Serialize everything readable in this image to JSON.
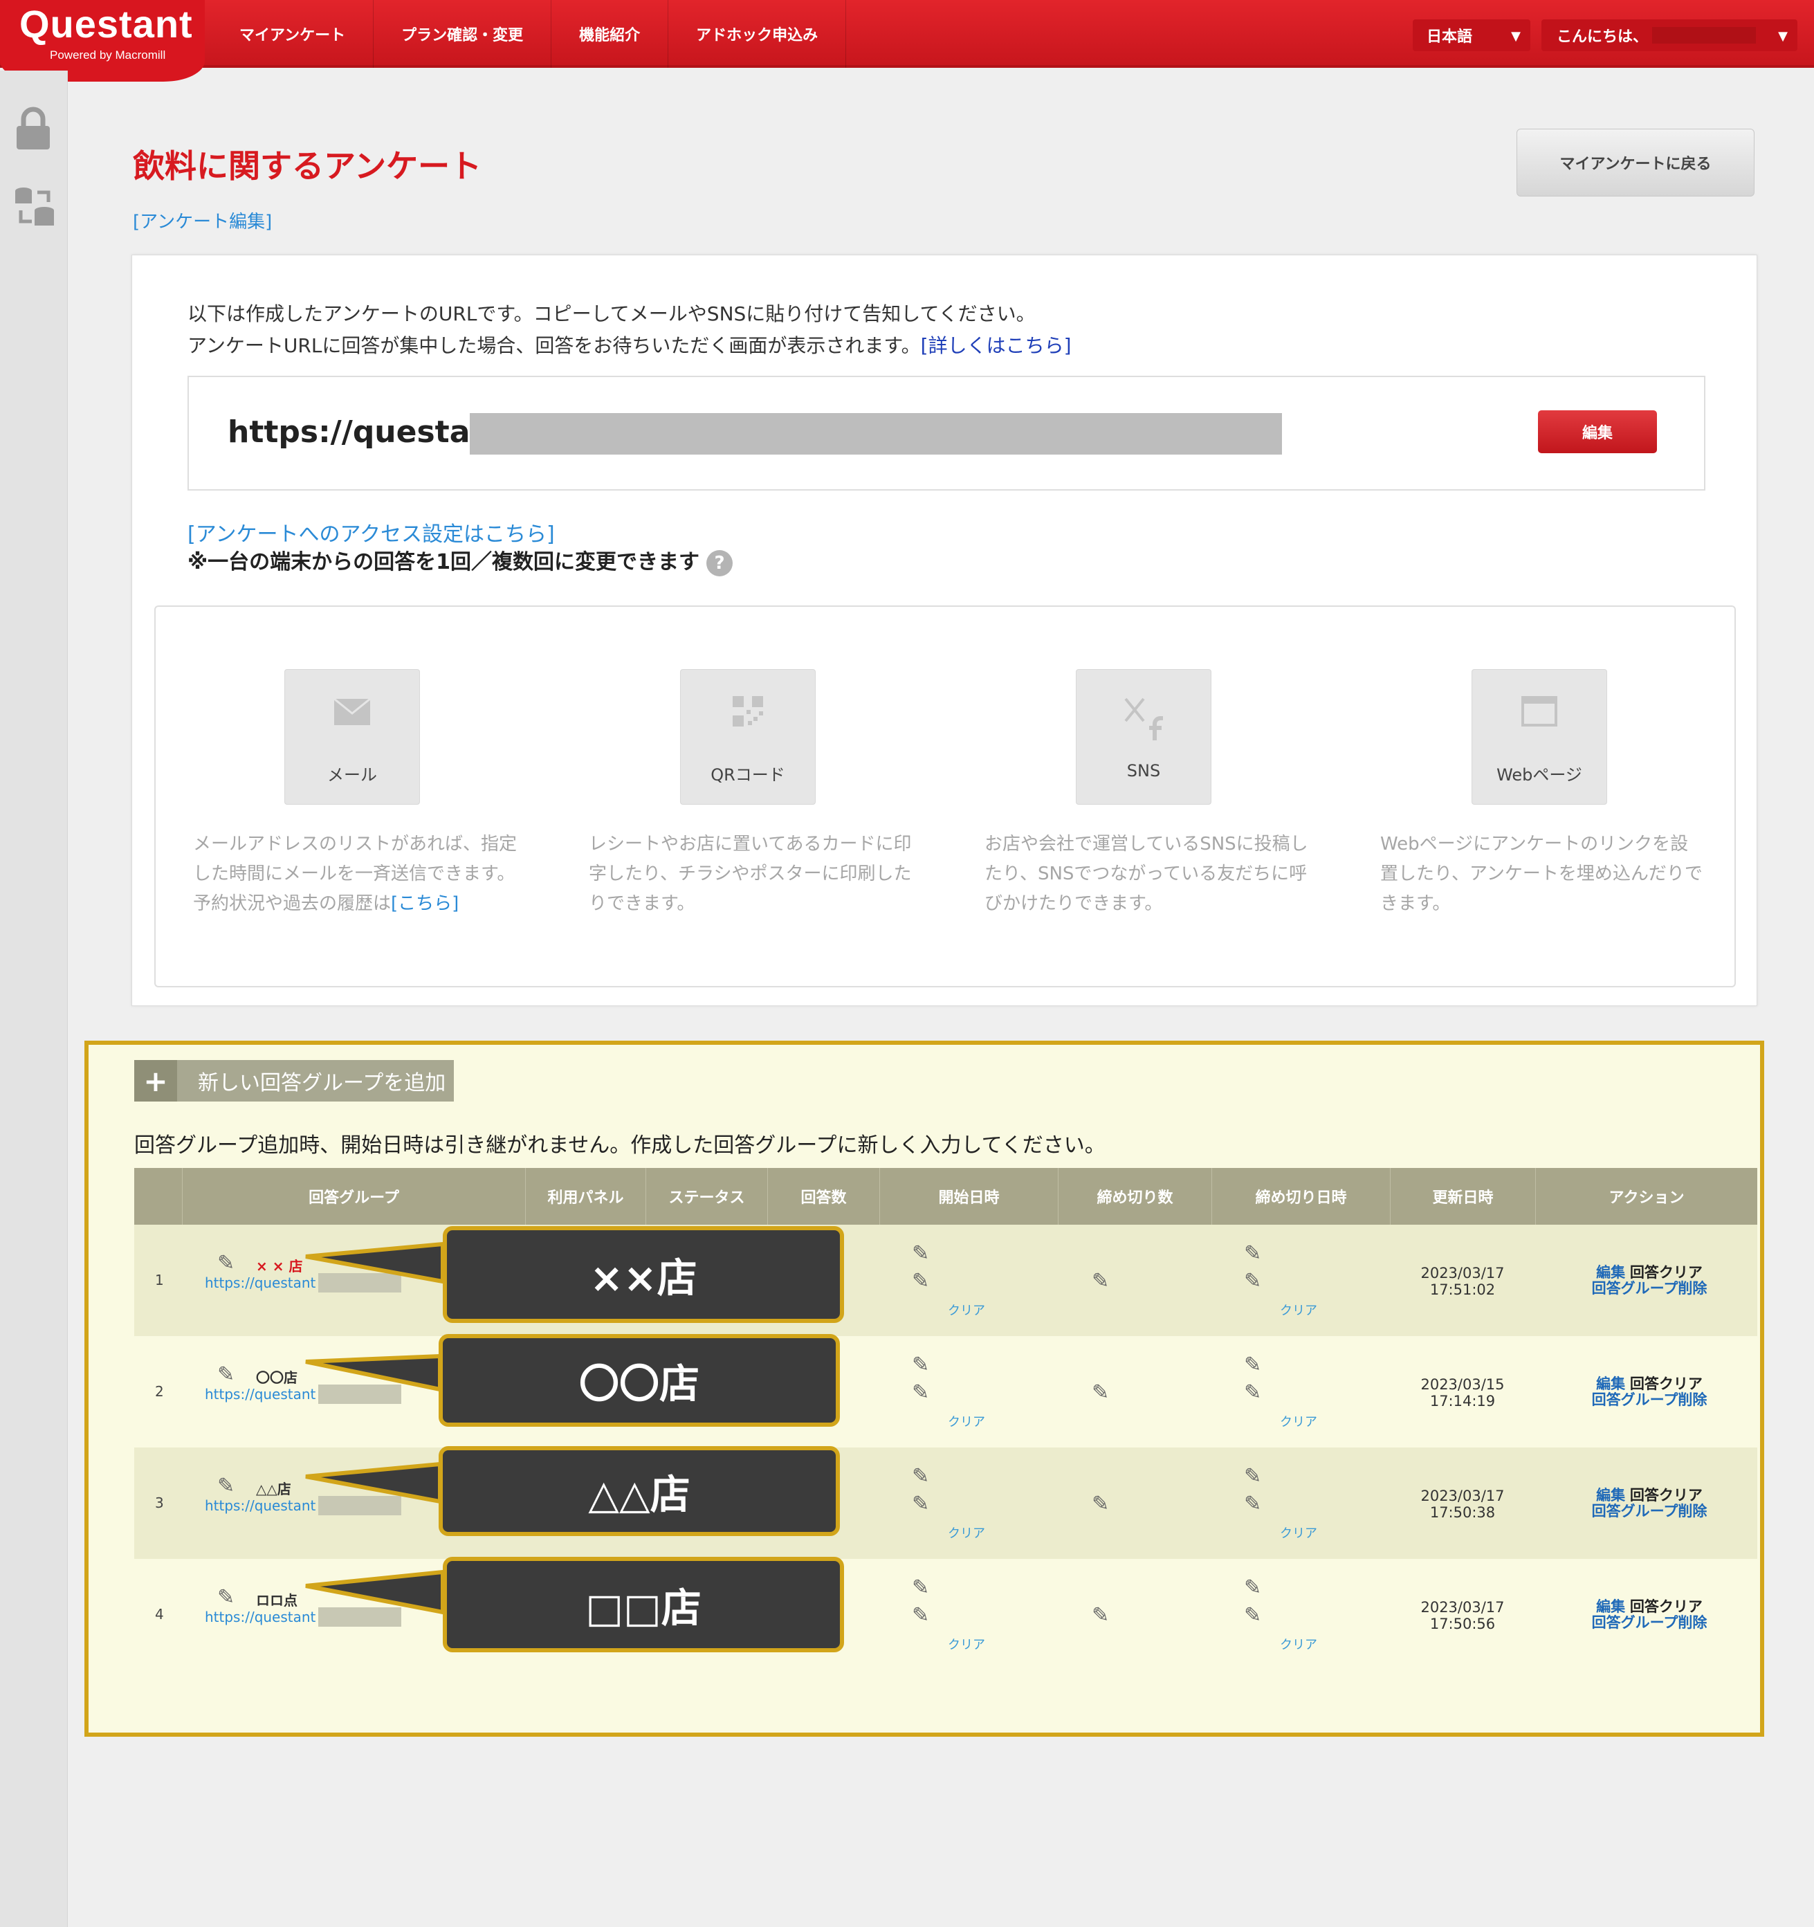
{
  "header": {
    "logo": "Questant",
    "logo_sub": "Powered by Macromill",
    "nav": [
      "マイアンケート",
      "プラン確認・変更",
      "機能紹介",
      "アドホック申込み"
    ],
    "language": "日本語",
    "greeting": "こんにちは、"
  },
  "sidebar": {
    "icons": [
      "lock-icon",
      "database-transfer-icon"
    ]
  },
  "page": {
    "title": "飲料に関するアンケート",
    "edit_link": "[アンケート編集]",
    "back_button": "マイアンケートに戻る"
  },
  "url_card": {
    "desc_line1": "以下は作成したアンケートのURLです。コピーしてメールやSNSに貼り付けて告知してください。",
    "desc_line2": "アンケートURLに回答が集中した場合、回答をお待ちいただく画面が表示されます。",
    "desc_link": "[詳しくはこちら]",
    "url": "https://questant",
    "edit_button": "編集",
    "access_link": "[アンケートへのアクセス設定はこちら]",
    "access_note": "※一台の端末からの回答を1回／複数回に変更できます",
    "help": "?"
  },
  "share": [
    {
      "label": "メール",
      "icon": "mail-icon",
      "desc": "メールアドレスのリストがあれば、指定した時間にメールを一斉送信できます。",
      "desc2": "予約状況や過去の履歴は",
      "link": "[こちら]"
    },
    {
      "label": "QRコード",
      "icon": "qr-code-icon",
      "desc": "レシートやお店に置いてあるカードに印字したり、チラシやポスターに印刷したりできます。",
      "desc2": "",
      "link": ""
    },
    {
      "label": "SNS",
      "icon": "x-facebook-icon",
      "desc": "お店や会社で運営しているSNSに投稿したり、SNSでつながっている友だちに呼びかけたりできます。",
      "desc2": "",
      "link": ""
    },
    {
      "label": "Webページ",
      "icon": "browser-window-icon",
      "desc": "Webページにアンケートのリンクを設置したり、アンケートを埋め込んだりできます。",
      "desc2": "",
      "link": ""
    }
  ],
  "groups": {
    "add_button": "新しい回答グループを追加",
    "note": "回答グループ追加時、開始日時は引き継がれません。作成した回答グループに新しく入力してください。",
    "columns": [
      "回答グループ",
      "利用パネル",
      "ステータス",
      "回答数",
      "開始日時",
      "締め切り数",
      "締め切り日時",
      "更新日時",
      "アクション"
    ],
    "clear_label": "クリア",
    "rows": [
      {
        "no": "1",
        "name": "× × 店",
        "url": "https://questant",
        "updated_date": "2023/03/17",
        "updated_time": "17:51:02",
        "callout": "××店"
      },
      {
        "no": "2",
        "name": "〇〇店",
        "url": "https://questant",
        "updated_date": "2023/03/15",
        "updated_time": "17:14:19",
        "callout": "〇〇店"
      },
      {
        "no": "3",
        "name": "△△店",
        "url": "https://questant",
        "updated_date": "2023/03/17",
        "updated_time": "17:50:38",
        "callout": "△△店"
      },
      {
        "no": "4",
        "name": "ロロ点",
        "url": "https://questant",
        "updated_date": "2023/03/17",
        "updated_time": "17:50:56",
        "callout": "□□店"
      }
    ],
    "actions": {
      "edit": "編集",
      "clear": "回答クリア",
      "delete": "回答グループ削除"
    }
  }
}
